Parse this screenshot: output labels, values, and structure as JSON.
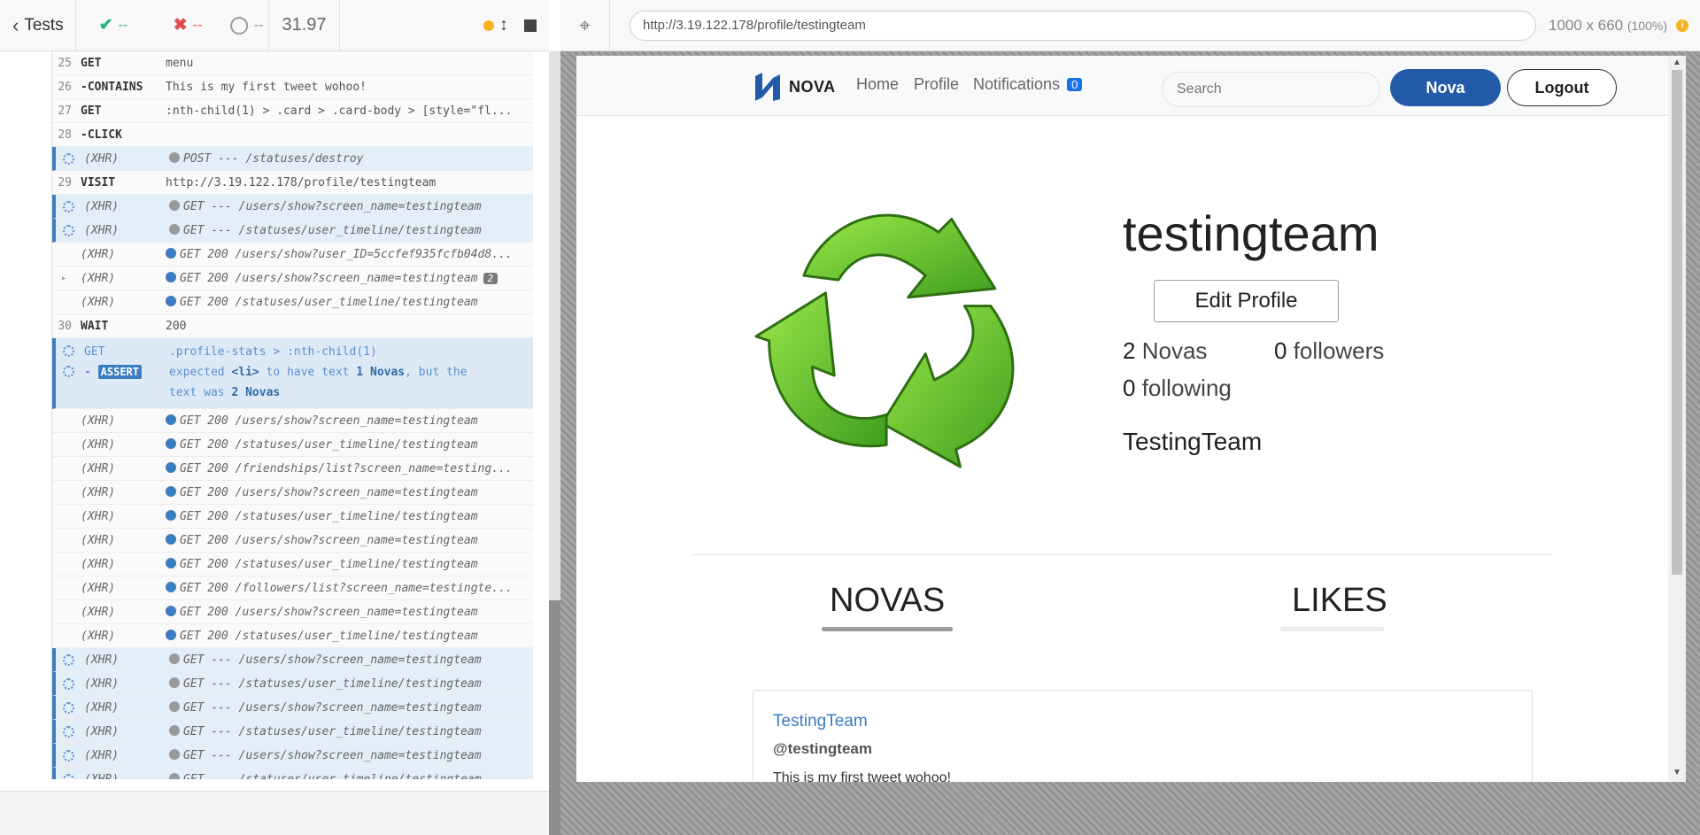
{
  "reporter": {
    "tests_label": "Tests",
    "passed": "--",
    "failed": "--",
    "pending": "--",
    "duration": "31.97",
    "commands": [
      {
        "num": "25",
        "name": "GET",
        "msg": "menu",
        "kind": "cmd"
      },
      {
        "num": "26",
        "name": "-CONTAINS",
        "msg": "This is my first tweet wohoo!",
        "kind": "cmd"
      },
      {
        "num": "27",
        "name": "GET",
        "msg": ":nth-child(1) > .card > .card-body > [style=\"fl...",
        "kind": "cmd"
      },
      {
        "num": "28",
        "name": "-CLICK",
        "msg": "",
        "kind": "cmd"
      },
      {
        "name": "(XHR)",
        "msg": "POST --- /statuses/destroy",
        "kind": "xhr-pending"
      },
      {
        "num": "29",
        "name": "VISIT",
        "msg": "http://3.19.122.178/profile/testingteam",
        "kind": "cmd"
      },
      {
        "name": "(XHR)",
        "msg": "GET --- /users/show?screen_name=testingteam",
        "kind": "xhr-pending"
      },
      {
        "name": "(XHR)",
        "msg": "GET --- /statuses/user_timeline/testingteam",
        "kind": "xhr-pending"
      },
      {
        "name": "(XHR)",
        "msg": "GET 200 /users/show?user_ID=5ccfef935fcfb04d8...",
        "kind": "xhr-done"
      },
      {
        "name": "(XHR)",
        "msg": "GET 200 /users/show?screen_name=testingteam",
        "kind": "xhr-done",
        "count": "2"
      },
      {
        "name": "(XHR)",
        "msg": "GET 200 /statuses/user_timeline/testingteam",
        "kind": "xhr-done"
      },
      {
        "num": "30",
        "name": "WAIT",
        "msg": "200",
        "kind": "cmd"
      }
    ],
    "assert": {
      "get_name": "GET",
      "get_msg": ".profile-stats > :nth-child(1)",
      "badge": "ASSERT",
      "msg_1": "expected",
      "msg_el": "<li>",
      "msg_2": "to have text",
      "msg_expected": "1 Novas",
      "msg_3": ", but the",
      "msg_4": "text was",
      "msg_actual": "2 Novas"
    },
    "xhr_after": [
      {
        "name": "(XHR)",
        "msg": "GET 200 /users/show?screen_name=testingteam",
        "kind": "xhr-done"
      },
      {
        "name": "(XHR)",
        "msg": "GET 200 /statuses/user_timeline/testingteam",
        "kind": "xhr-done"
      },
      {
        "name": "(XHR)",
        "msg": "GET 200 /friendships/list?screen_name=testing...",
        "kind": "xhr-done"
      },
      {
        "name": "(XHR)",
        "msg": "GET 200 /users/show?screen_name=testingteam",
        "kind": "xhr-done"
      },
      {
        "name": "(XHR)",
        "msg": "GET 200 /statuses/user_timeline/testingteam",
        "kind": "xhr-done"
      },
      {
        "name": "(XHR)",
        "msg": "GET 200 /users/show?screen_name=testingteam",
        "kind": "xhr-done"
      },
      {
        "name": "(XHR)",
        "msg": "GET 200 /statuses/user_timeline/testingteam",
        "kind": "xhr-done"
      },
      {
        "name": "(XHR)",
        "msg": "GET 200 /followers/list?screen_name=testingte...",
        "kind": "xhr-done"
      },
      {
        "name": "(XHR)",
        "msg": "GET 200 /users/show?screen_name=testingteam",
        "kind": "xhr-done"
      },
      {
        "name": "(XHR)",
        "msg": "GET 200 /statuses/user_timeline/testingteam",
        "kind": "xhr-done"
      },
      {
        "name": "(XHR)",
        "msg": "GET --- /users/show?screen_name=testingteam",
        "kind": "xhr-pending"
      },
      {
        "name": "(XHR)",
        "msg": "GET --- /statuses/user_timeline/testingteam",
        "kind": "xhr-pending"
      },
      {
        "name": "(XHR)",
        "msg": "GET --- /users/show?screen_name=testingteam",
        "kind": "xhr-pending"
      },
      {
        "name": "(XHR)",
        "msg": "GET --- /statuses/user_timeline/testingteam",
        "kind": "xhr-pending"
      },
      {
        "name": "(XHR)",
        "msg": "GET --- /users/show?screen_name=testingteam",
        "kind": "xhr-pending"
      },
      {
        "name": "(XHR)",
        "msg": "GET --- /statuses/user_timeline/testingteam",
        "kind": "xhr-pending"
      }
    ]
  },
  "aut": {
    "url": "http://3.19.122.178/profile/testingteam",
    "viewport": "1000 x 660",
    "zoom": "(100%)"
  },
  "app": {
    "logo_text": "NOVA",
    "nav": {
      "home": "Home",
      "profile": "Profile",
      "notifications": "Notifications",
      "notif_count": "0",
      "search_placeholder": "Search",
      "nova_button": "Nova",
      "logout_button": "Logout"
    },
    "profile": {
      "username": "testingteam",
      "edit_button": "Edit Profile",
      "novas_count": "2",
      "novas_label": "Novas",
      "followers_count": "0",
      "followers_label": "followers",
      "following_count": "0",
      "following_label": "following",
      "display_name": "TestingTeam"
    },
    "tabs": {
      "novas": "NOVAS",
      "likes": "LIKES"
    },
    "tweet": {
      "name": "TestingTeam",
      "handle": "@testingteam",
      "body": "This is my first tweet wohoo!"
    }
  },
  "colors": {
    "accent": "#235ba8",
    "pass": "#2cb67d",
    "fail": "#e14b4b",
    "running": "#f6b21b",
    "xhr_blue": "#3b7dc0"
  }
}
